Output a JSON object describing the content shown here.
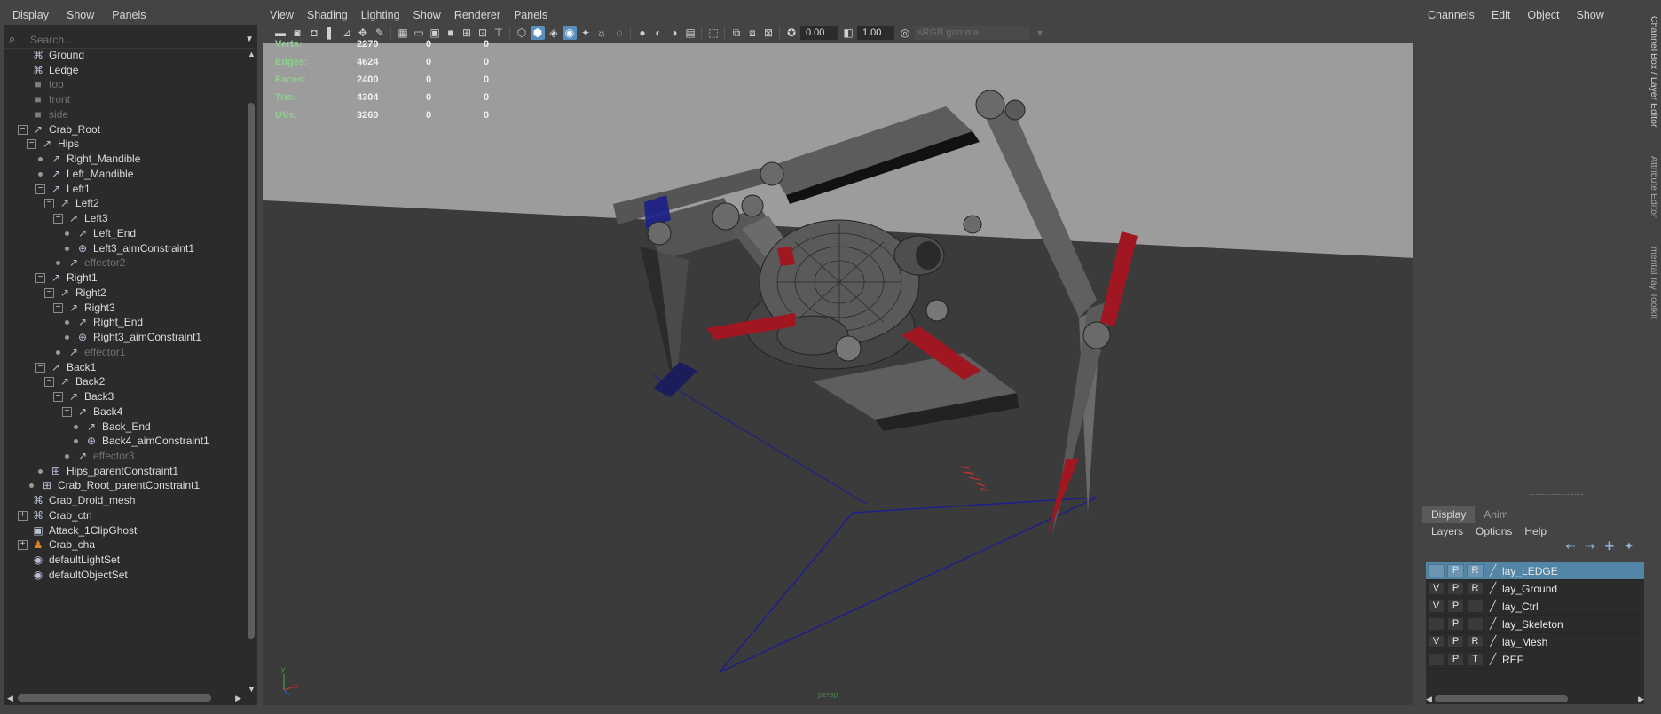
{
  "outliner": {
    "menu": [
      "Display",
      "Show",
      "Panels"
    ],
    "search_placeholder": "Search...",
    "nodes": [
      {
        "label": "Ground",
        "icon": "camera-group-icon",
        "glyph": "⌘"
      },
      {
        "label": "Ledge",
        "icon": "camera-group-icon",
        "glyph": "⌘"
      },
      {
        "label": "top",
        "icon": "camera-icon",
        "glyph": "■"
      },
      {
        "label": "front",
        "icon": "camera-icon",
        "glyph": "■"
      },
      {
        "label": "side",
        "icon": "camera-icon",
        "glyph": "■"
      },
      {
        "label": "Crab_Root",
        "icon": "joint-icon",
        "glyph": "↗"
      },
      {
        "label": "Hips",
        "icon": "joint-icon",
        "glyph": "↗"
      },
      {
        "label": "Right_Mandible",
        "icon": "joint-icon",
        "glyph": "↗"
      },
      {
        "label": "Left_Mandible",
        "icon": "joint-icon",
        "glyph": "↗"
      },
      {
        "label": "Left1",
        "icon": "joint-icon",
        "glyph": "↗"
      },
      {
        "label": "Left2",
        "icon": "joint-icon",
        "glyph": "↗"
      },
      {
        "label": "Left3",
        "icon": "joint-icon",
        "glyph": "↗"
      },
      {
        "label": "Left_End",
        "icon": "joint-icon",
        "glyph": "↗"
      },
      {
        "label": "Left3_aimConstraint1",
        "icon": "aim-constraint-icon",
        "glyph": "⊕"
      },
      {
        "label": "effector2",
        "icon": "effector-icon",
        "glyph": "↗"
      },
      {
        "label": "Right1",
        "icon": "joint-icon",
        "glyph": "↗"
      },
      {
        "label": "Right2",
        "icon": "joint-icon",
        "glyph": "↗"
      },
      {
        "label": "Right3",
        "icon": "joint-icon",
        "glyph": "↗"
      },
      {
        "label": "Right_End",
        "icon": "joint-icon",
        "glyph": "↗"
      },
      {
        "label": "Right3_aimConstraint1",
        "icon": "aim-constraint-icon",
        "glyph": "⊕"
      },
      {
        "label": "effector1",
        "icon": "effector-icon",
        "glyph": "↗"
      },
      {
        "label": "Back1",
        "icon": "joint-icon",
        "glyph": "↗"
      },
      {
        "label": "Back2",
        "icon": "joint-icon",
        "glyph": "↗"
      },
      {
        "label": "Back3",
        "icon": "joint-icon",
        "glyph": "↗"
      },
      {
        "label": "Back4",
        "icon": "joint-icon",
        "glyph": "↗"
      },
      {
        "label": "Back_End",
        "icon": "joint-icon",
        "glyph": "↗"
      },
      {
        "label": "Back4_aimConstraint1",
        "icon": "aim-constraint-icon",
        "glyph": "⊕"
      },
      {
        "label": "effector3",
        "icon": "effector-icon",
        "glyph": "↗"
      },
      {
        "label": "Hips_parentConstraint1",
        "icon": "parent-constraint-icon",
        "glyph": "⊞"
      },
      {
        "label": "Crab_Root_parentConstraint1",
        "icon": "parent-constraint-icon",
        "glyph": "⊞"
      },
      {
        "label": "Crab_Droid_mesh",
        "icon": "group-icon",
        "glyph": "⌘"
      },
      {
        "label": "Crab_ctrl",
        "icon": "group-icon",
        "glyph": "⌘"
      },
      {
        "label": "Attack_1ClipGhost",
        "icon": "clip-ghost-icon",
        "glyph": "▣"
      },
      {
        "label": "Crab_cha",
        "icon": "character-icon",
        "glyph": "♟"
      },
      {
        "label": "defaultLightSet",
        "icon": "set-icon",
        "glyph": "◉"
      },
      {
        "label": "defaultObjectSet",
        "icon": "set-icon",
        "glyph": "◉"
      }
    ]
  },
  "viewport": {
    "menu": [
      "View",
      "Shading",
      "Lighting",
      "Show",
      "Renderer",
      "Panels"
    ],
    "exposure": "0.00",
    "gamma_value": "1.00",
    "color_space": "sRGB gamma",
    "camera": "persp",
    "hud": [
      {
        "label": "Verts:",
        "v1": "2270",
        "v2": "0",
        "v3": "0"
      },
      {
        "label": "Edges:",
        "v1": "4624",
        "v2": "0",
        "v3": "0"
      },
      {
        "label": "Faces:",
        "v1": "2400",
        "v2": "0",
        "v3": "0"
      },
      {
        "label": "Tris:",
        "v1": "4304",
        "v2": "0",
        "v3": "0"
      },
      {
        "label": "UVs:",
        "v1": "3260",
        "v2": "0",
        "v3": "0"
      }
    ],
    "axis": {
      "y": "y",
      "x": "x"
    },
    "colors": {
      "background": "#3c3c3c",
      "floor": "#3b3b3b",
      "wall": "#9c9c9c",
      "accent_red": "#a01722",
      "ik_blue": "#1d1f8a"
    }
  },
  "channels": {
    "menu": [
      "Channels",
      "Edit",
      "Object",
      "Show"
    ],
    "tabs": {
      "display": "Display",
      "anim": "Anim"
    },
    "layer_menu": [
      "Layers",
      "Options",
      "Help"
    ],
    "layers": [
      {
        "name": "lay_LEDGE",
        "v": "",
        "p": "P",
        "r": "R",
        "selected": true
      },
      {
        "name": "lay_Ground",
        "v": "V",
        "p": "P",
        "r": "R",
        "selected": false
      },
      {
        "name": "lay_Ctrl",
        "v": "V",
        "p": "P",
        "r": "",
        "selected": false
      },
      {
        "name": "lay_Skeleton",
        "v": "",
        "p": "P",
        "r": "",
        "selected": false
      },
      {
        "name": "lay_Mesh",
        "v": "V",
        "p": "P",
        "r": "R",
        "selected": false
      },
      {
        "name": "REF",
        "v": "",
        "p": "P",
        "r": "T",
        "selected": false
      }
    ]
  },
  "side_tabs": [
    "Channel Box / Layer Editor",
    "Attribute Editor",
    "mental ray Toolkit"
  ]
}
